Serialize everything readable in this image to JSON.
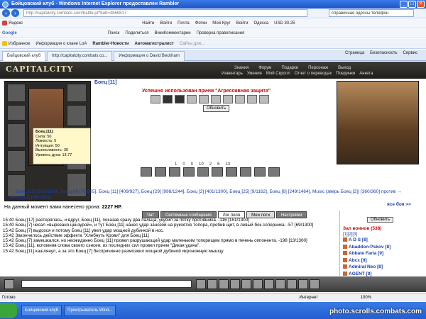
{
  "window": {
    "title": "Бойцовский клуб - Windows Internet Explorer предоставлен Rambler"
  },
  "browser": {
    "address": "http://capitalcity.combats.com/battle.pl?batt=4869817",
    "search_value": "справочная одессы телефон",
    "toolbar1": [
      "Яндекс",
      "Найти",
      "Войти",
      "Почта",
      "Фотки",
      "Мой Круг",
      "Войти",
      "Одесса",
      "USD 30.25"
    ],
    "toolbar2": [
      "Google",
      "Поиск",
      "Поделиться",
      "ВикиКомментарии",
      "Проверка правописания"
    ],
    "favorites": [
      "Избранное",
      "Информация о клане LoA",
      "Rambler-Новости",
      "Автомагистралист",
      "Сайты для..."
    ],
    "tabs": [
      "Бойцовский клуб",
      "http://capitalcity.combats.co...",
      "Информация о David Beckham"
    ],
    "page_tools": [
      "Страница",
      "Безопасность",
      "Сервис"
    ]
  },
  "game": {
    "logo": "CAPITALCITY",
    "nav1": [
      "Знания",
      "Форум",
      "Подарки",
      "Персонаж",
      "Выход"
    ],
    "nav2": [
      "Инвентарь",
      "Умения",
      "Мой Скролл",
      "Отчет о переводах",
      "Поединки",
      "Анкета"
    ],
    "fighter_title": "Боец [11]",
    "message": "Успешно использован прием \"Агрессивная защита\"",
    "refresh": "Обновить",
    "tooltip": [
      "Боец [11]",
      "Сила: 50",
      "Ловкость: 5",
      "Интуиция: 50",
      "Выносливость: 30",
      "",
      "Уровень духа: 13.77"
    ],
    "counters": [
      "1",
      "0",
      "0",
      "10",
      "2",
      "6",
      "13"
    ],
    "fighters_line": "→ Боец [12] [592/1189], Боец [8] [76/895], Боец [11] [409/927], Боец [29] [998/1244], Боец [2] [401/1300], Боец [25] [9/1162], Боец [6] [249/1464], Music (зверь Боец [2]) [360/360] против → Боец [17] [98/1300]",
    "next_fight": "ясе боя >>",
    "damage_text": "На данный момент вами нанесено урона:",
    "damage_value": "2227 HP.",
    "chat_tabs": [
      "Чат",
      "Системные сообщения",
      "Лог поля",
      "Мои логи",
      "Настройки"
    ],
    "chat": [
      "15:40 Боец [17] растерялась, и вдруг, Боец [11], показав сразу два пальца, укусил за пятку противника. -116 [151/1300]",
      "15:40 Боец [7] чесал «вырезано цензурой», и тут Боец [11] нанес удар занозой на рукоятке топора, пробив щит, в левый бок соперника. -57 [69/1300]",
      "15:42 Боец [7] выдохся и потому Боец [11] увел удар мощной дубинкой в нос.",
      "15:42 Закончилось действие эффекта \"Хлебнуть Крови\" для Боец [11]",
      "15:42 Боец [7] замешкался, но неожиданно Боец [11] провел разрушающий удар маленьким топорищем прямо в печень оппонента. -198 [13/1300]",
      "15:42 Боец [11], вспомнив слова своего сэнсея, из последних сил провел прием \"Дикая удача\".",
      "15:42 Боец [11] кашлянул, а за это Боец [7] беспричинно размозжил мощной дубиной икроножную мышцу"
    ],
    "sidebar": {
      "update": "Обновить",
      "header": "Зал воинов (538)",
      "pages": "[1][2][3]",
      "players": [
        "A D S [8]",
        "Abaddon-Pskov [8]",
        "Abbate Faria [9]",
        "Abcx [9]",
        "Admiral Neo [8]",
        "AGENT [9]"
      ]
    }
  },
  "status": {
    "left": "Готово",
    "zone": "Интернет",
    "zoom": "100%"
  },
  "taskbar": [
    "Бойцовский клуб",
    "Проигрыватель Wind..."
  ],
  "watermark": "photo.scrolls.combats.com"
}
